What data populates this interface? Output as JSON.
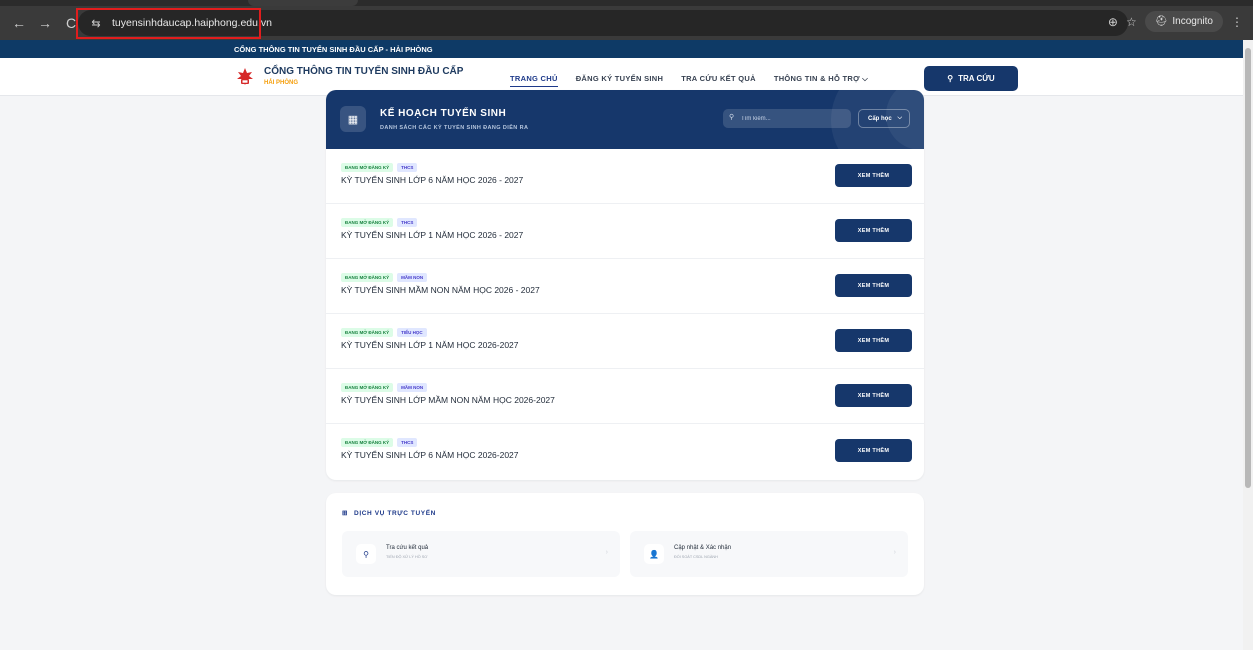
{
  "browser": {
    "url": "tuyensinhdaucap.haiphong.edu.vn",
    "incognito_label": "Incognito",
    "back_icon": "←",
    "forward_icon": "→",
    "reload_icon": "C",
    "site_icon": "⇆",
    "zoom_icon": "⊕",
    "star_icon": "☆",
    "incog_icon": "⛑",
    "menu_icon": "⋮"
  },
  "topstrip": {
    "text": "CỔNG THÔNG TIN TUYỂN SINH ĐẦU CẤP - HẢI PHÒNG"
  },
  "header": {
    "brand_title": "CỔNG THÔNG TIN TUYỂN SINH ĐẦU CẤP",
    "brand_sub": "HẢI PHÒNG",
    "menu": [
      {
        "label": "TRANG CHỦ"
      },
      {
        "label": "ĐĂNG KÝ TUYỂN SINH"
      },
      {
        "label": "TRA CỨU KẾT QUẢ"
      },
      {
        "label": "THÔNG TIN & HỖ TRỢ ⌵"
      }
    ],
    "search_button": "TRA CỨU",
    "search_icon": "⚲"
  },
  "plan": {
    "icon": "▦",
    "title": "KẾ HOẠCH TUYỂN SINH",
    "subtitle": "DANH SÁCH CÁC KỲ TUYỂN SINH ĐANG DIỄN RA",
    "search_placeholder": "Tìm kiếm...",
    "search_icon": "⚲",
    "level_select": "Cấp học",
    "chevron": "⌵",
    "button_label": "XEM THÊM",
    "rows": [
      {
        "status": "ĐANG MỞ ĐĂNG KÝ",
        "level": "THCS",
        "title": "KỲ TUYỂN SINH LỚP 6 NĂM HỌC 2026 - 2027"
      },
      {
        "status": "ĐANG MỞ ĐĂNG KÝ",
        "level": "THCS",
        "title": "KỲ TUYỂN SINH LỚP 1 NĂM HỌC 2026 - 2027"
      },
      {
        "status": "ĐANG MỞ ĐĂNG KÝ",
        "level": "MẦM NON",
        "title": "KỲ TUYỂN SINH MẦM NON NĂM HỌC 2026 - 2027"
      },
      {
        "status": "ĐANG MỞ ĐĂNG KÝ",
        "level": "TIỂU HỌC",
        "title": "KỲ TUYỂN SINH LỚP 1 NĂM HỌC 2026-2027"
      },
      {
        "status": "ĐANG MỞ ĐĂNG KÝ",
        "level": "MẦM NON",
        "title": "KỲ TUYỂN SINH LỚP MẦM NON NĂM HỌC 2026-2027"
      },
      {
        "status": "ĐANG MỞ ĐĂNG KÝ",
        "level": "THCS",
        "title": "KỲ TUYỂN SINH LỚP 6 NĂM HỌC 2026-2027"
      }
    ]
  },
  "services": {
    "title": "DỊCH VỤ TRỰC TUYẾN",
    "title_icon": "⊞",
    "arrow": "›",
    "items": [
      {
        "label": "Tra cứu kết quả",
        "sub": "TIẾN ĐỘ XỬ LÝ HỒ SƠ",
        "icon": "⚲"
      },
      {
        "label": "Cập nhật & Xác nhận",
        "sub": "ĐỐI SOÁT CSDL NGÀNH",
        "icon": "👤"
      }
    ]
  },
  "colors": {
    "brand": "#16376b",
    "accent": "#f59e0b",
    "url_highlight": "#e11d1d"
  }
}
